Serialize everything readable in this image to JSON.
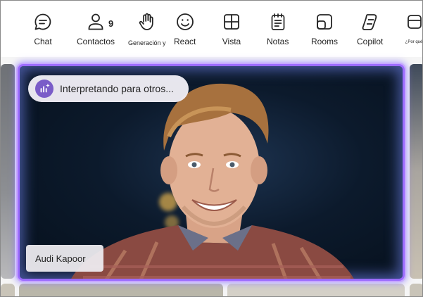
{
  "toolbar": {
    "items": [
      {
        "label": "Chat",
        "icon": "chat-icon"
      },
      {
        "label": "Contactos",
        "icon": "people-icon",
        "count": "9"
      },
      {
        "label": "Generación y",
        "icon": "raise-hand-icon"
      },
      {
        "label": "React",
        "icon": "emoji-icon"
      },
      {
        "label": "Vista",
        "icon": "view-grid-icon"
      },
      {
        "label": "Notas",
        "icon": "notes-icon"
      },
      {
        "label": "Rooms",
        "icon": "rooms-icon"
      },
      {
        "label": "Copilot",
        "icon": "copilot-icon"
      },
      {
        "label": "¿Por qué",
        "icon": "more-icon"
      }
    ]
  },
  "stage": {
    "interpreting_label": "Interpretando para otros...",
    "participant_name": "Audi Kapoor"
  },
  "colors": {
    "tile_glow": "#9c6cff",
    "chip_icon": "#7a5cc8",
    "background": "#ffffff"
  }
}
